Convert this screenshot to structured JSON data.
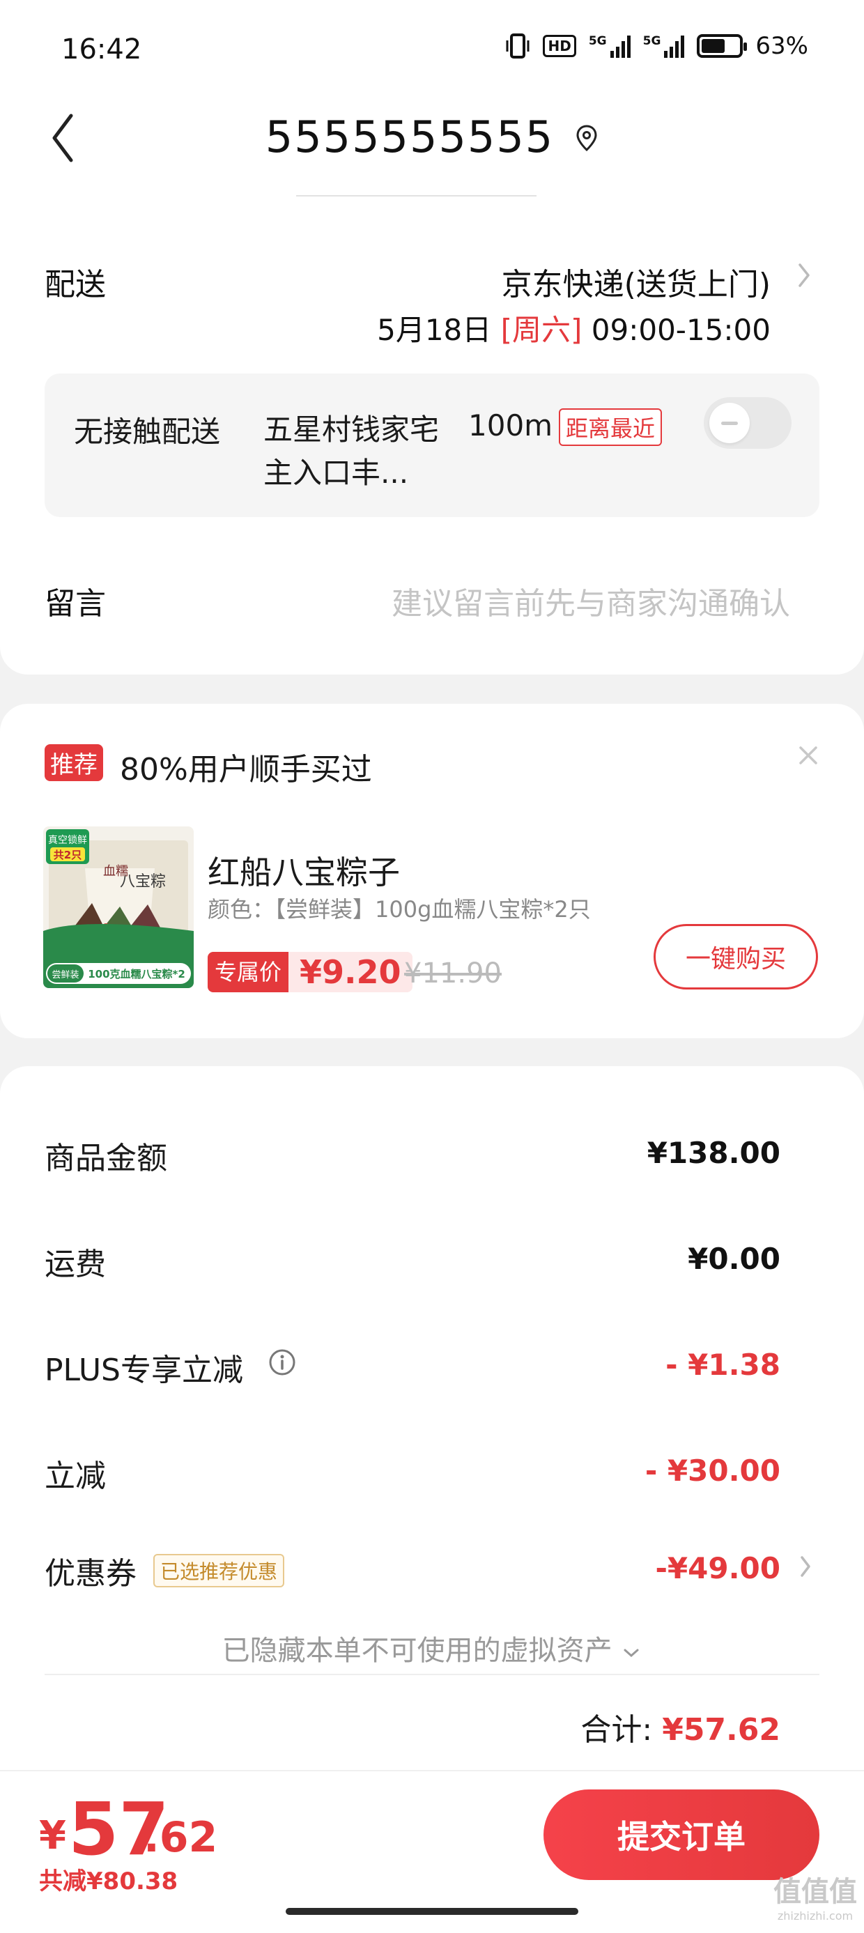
{
  "status_bar": {
    "time": "16:42",
    "hd_label": "HD",
    "net1": "5G",
    "net2": "5G",
    "battery_percent": 63,
    "battery_label": "63%",
    "icons": [
      "vibrate-icon",
      "hd-icon",
      "signal-icon",
      "signal-icon",
      "battery-icon"
    ]
  },
  "header": {
    "title": "5555555555",
    "back_icon": "chevron-left-icon",
    "location_icon": "location-pin-icon"
  },
  "delivery": {
    "label": "配送",
    "method": "京东快递(送货上门)",
    "date": "5月18日",
    "weekday": "[周六]",
    "time_window": "09:00-15:00",
    "contactless": {
      "label": "无接触配送",
      "address": "五星村钱家宅主入口丰...",
      "distance": "100m",
      "badge": "距离最近",
      "enabled": false
    }
  },
  "message": {
    "label": "留言",
    "placeholder": "建议留言前先与商家沟通确认"
  },
  "recommend": {
    "tag": "推荐",
    "title": "80%用户顺手买过",
    "product": {
      "name": "红船八宝粽子",
      "spec": "颜色：【尝鲜装】100g血糯八宝粽*2只",
      "price_tag": "专属价",
      "price": "¥9.20",
      "original_price": "¥11.90",
      "buy_label": "一键购买",
      "image": {
        "badge_top": "真空锁鲜",
        "badge_count": "共2只",
        "title_text": "八宝粽",
        "brand_text": "血糯",
        "banner_tag": "尝鲜装",
        "banner_text": "100克血糯八宝粽*2"
      }
    }
  },
  "amounts": {
    "goods_label": "商品金额",
    "goods_value": "¥138.00",
    "shipping_label": "运费",
    "shipping_value": "¥0.00",
    "plus_label": "PLUS专享立减",
    "plus_value": "- ¥1.38",
    "instant_label": "立减",
    "instant_value": "- ¥30.00",
    "coupon_label": "优惠券",
    "coupon_badge": "已选推荐优惠",
    "coupon_value": "-¥49.00",
    "hidden_note": "已隐藏本单不可使用的虚拟资产",
    "total_label": "合计:",
    "total_value": "¥57.62"
  },
  "bottom": {
    "currency": "¥",
    "pay_int": "57",
    "pay_dec": ".62",
    "saved": "共减¥80.38",
    "submit_label": "提交订单"
  },
  "watermark": {
    "text": "值值值",
    "sub": "zhizhizhi.com"
  },
  "colors": {
    "accent": "#e4393c",
    "muted": "#999999",
    "placeholder": "#c4c4c4"
  }
}
